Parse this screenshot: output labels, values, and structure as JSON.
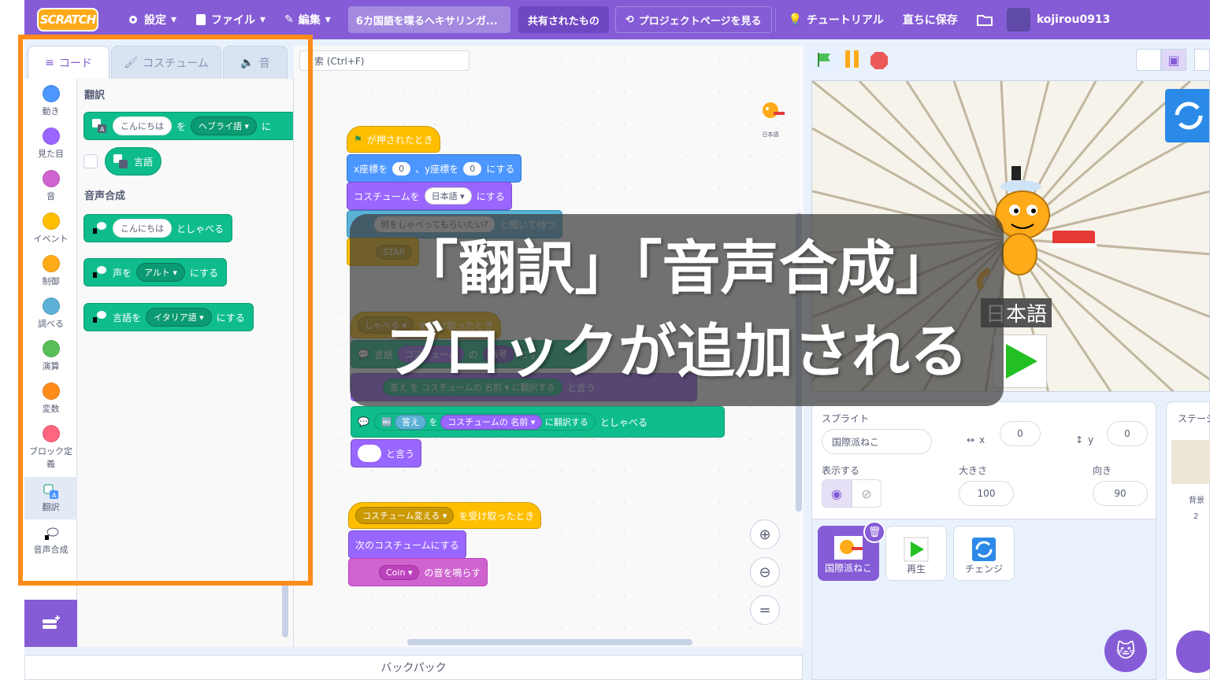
{
  "menubar": {
    "logo": "SCRATCH",
    "settings": "設定",
    "file": "ファイル",
    "edit": "編集",
    "project_title": "6カ国語を喋るヘキサリンガ...",
    "shared": "共有されたもの",
    "project_page": "プロジェクトページを見る",
    "tutorials": "チュートリアル",
    "save_now": "直ちに保存",
    "username": "kojirou0913"
  },
  "tabs": {
    "code": "コード",
    "costumes": "コスチューム",
    "sounds": "音"
  },
  "search": {
    "placeholder": "検索 (Ctrl+F)",
    "visible": "索 (Ctrl+F)"
  },
  "categories": [
    {
      "label": "動き",
      "color": "#4c97ff"
    },
    {
      "label": "見た目",
      "color": "#9966ff"
    },
    {
      "label": "音",
      "color": "#cf63cf"
    },
    {
      "label": "イベント",
      "color": "#ffbf00"
    },
    {
      "label": "制御",
      "color": "#ffab19"
    },
    {
      "label": "調べる",
      "color": "#5cb1d6"
    },
    {
      "label": "演算",
      "color": "#59c059"
    },
    {
      "label": "変数",
      "color": "#ff8c1a"
    },
    {
      "label": "ブロック定義",
      "color": "#ff6680"
    },
    {
      "label": "翻訳",
      "color": ""
    },
    {
      "label": "音声合成",
      "color": ""
    }
  ],
  "flyout": {
    "translate_head": "翻訳",
    "tts_head": "音声合成",
    "translate_block": {
      "text": "こんにちは",
      "wo": "を",
      "lang": "ヘブライ語",
      "ni": "に"
    },
    "language_reporter": "言語",
    "speak_block": {
      "text": "こんにちは",
      "suffix": "としゃべる"
    },
    "voice_block": {
      "prefix": "声を",
      "voice": "アルト",
      "suffix": "にする"
    },
    "lang_block": {
      "prefix": "言語を",
      "lang": "イタリア語",
      "suffix": "にする"
    }
  },
  "script": {
    "flag_hat": "が押されたとき",
    "goto": {
      "x_label": "x座標を",
      "x": "0",
      "y_label": "、y座標を",
      "y": "0",
      "suffix": "にする"
    },
    "costume": {
      "prefix": "コスチュームを",
      "value": "日本語",
      "suffix": "にする"
    },
    "ask": {
      "text": "何をしゃべってもらいたい?",
      "suffix": "と聞いて待つ"
    },
    "broadcast_partial": "STAR",
    "recv_hat": {
      "value": "しゃべる",
      "suffix": "を受け取ったとき"
    },
    "set_lang": {
      "prefix": "言語",
      "mid1": "コスチューム",
      "mid2": "の",
      "value": "番号",
      "suffix": "にする"
    },
    "say_translate": {
      "ans": "答え",
      "wo": "を",
      "costume": "コスチュームの",
      "name": "名前",
      "mid": "に翻訳する",
      "suffix": "と言う"
    },
    "speak_translate": {
      "ans": "答え",
      "wo": "を",
      "costume": "コスチュームの",
      "name": "名前",
      "mid": "に翻訳する",
      "suffix": "としゃべる"
    },
    "say_empty": {
      "suffix": "と言う"
    },
    "recv2": {
      "value": "コスチューム変える",
      "suffix": "を受け取ったとき"
    },
    "next_costume": "次のコスチュームにする",
    "play_sound": {
      "value": "Coin",
      "suffix": "の音を鳴らす"
    },
    "sprite_thumb_label": "日本語"
  },
  "stage": {
    "language_label": "日本語"
  },
  "sprite_info": {
    "sprite_label": "スプライト",
    "sprite_name": "国際派ねこ",
    "x_label": "x",
    "x": "0",
    "y_label": "y",
    "y": "0",
    "show_label": "表示する",
    "size_label": "大きさ",
    "size": "100",
    "direction_label": "向き",
    "direction": "90"
  },
  "sprites": [
    {
      "name": "国際派ねこ",
      "selected": true
    },
    {
      "name": "再生",
      "selected": false
    },
    {
      "name": "チェンジ",
      "selected": false
    }
  ],
  "stage_pane": {
    "title": "ステージ",
    "backdrop_label": "背景",
    "backdrop_count": "2"
  },
  "backpack": "バックパック",
  "overlay": {
    "line1": "「翻訳」「音声合成」",
    "line2": "ブロックが追加される"
  },
  "colors": {
    "accent": "#855cd6",
    "highlight": "#ff8c1a",
    "extension": "#0fbd8c"
  }
}
